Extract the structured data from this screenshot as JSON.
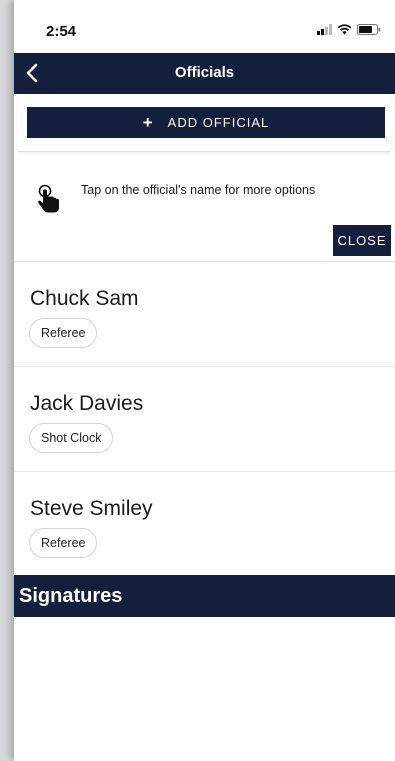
{
  "status_bar": {
    "time": "2:54",
    "icons": [
      "signal-icon",
      "wifi-icon",
      "battery-icon"
    ]
  },
  "nav": {
    "title": "Officials",
    "back_icon": "chevron-left-icon"
  },
  "add_button": {
    "icon": "plus",
    "label": "ADD OFFICIAL"
  },
  "hint": {
    "icon": "pointing-hand-icon",
    "text": "Tap on the official's name for more options",
    "close_label": "CLOSE"
  },
  "officials": [
    {
      "name": "Chuck Sam",
      "role": "Referee"
    },
    {
      "name": "Jack Davies",
      "role": "Shot Clock"
    },
    {
      "name": "Steve Smiley",
      "role": "Referee"
    }
  ],
  "signatures": {
    "title": "Signatures"
  },
  "colors": {
    "navy": "#141f3d",
    "background": "#ffffff",
    "outer": "#d6d8dc"
  }
}
